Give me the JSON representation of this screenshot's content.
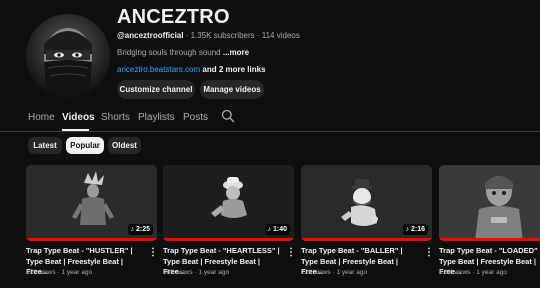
{
  "channel": {
    "name": "ANCEZTRO",
    "handle": "@anceztroofficial",
    "stats": "· 1.35K subscribers · 114 videos",
    "description": "Bridging souls through sound",
    "description_more": "...more",
    "link": "anceztro.beatstars.com",
    "more_links": "and 2 more links",
    "customize_label": "Customize channel",
    "manage_label": "Manage videos"
  },
  "tabs": [
    {
      "label": "Home",
      "active": false
    },
    {
      "label": "Videos",
      "active": true
    },
    {
      "label": "Shorts",
      "active": false
    },
    {
      "label": "Playlists",
      "active": false
    },
    {
      "label": "Posts",
      "active": false
    }
  ],
  "filters": [
    {
      "label": "Latest",
      "active": false
    },
    {
      "label": "Popular",
      "active": true
    },
    {
      "label": "Oldest",
      "active": false
    }
  ],
  "videos": [
    {
      "title": "Trap Type Beat - \"HUSTLER\" | Type Beat | Freestyle Beat | Free...",
      "duration": "2:25",
      "views": "62K views · 1 year ago",
      "watched": 1.0
    },
    {
      "title": "Trap Type Beat - \"HEARTLESS\" | Type Beat | Freestyle Beat | Free...",
      "duration": "1:40",
      "views": "38K views · 1 year ago",
      "watched": 1.0
    },
    {
      "title": "Trap Type Beat - \"BALLER\" | Type Beat | Freestyle Beat | Free...",
      "duration": "2:16",
      "views": "22K views · 1 year ago",
      "watched": 1.0
    },
    {
      "title": "Trap Type Beat - \"LOADED\" | Type Beat | Freestyle Beat | Free...",
      "duration": "",
      "views": "6.6K views · 1 year ago",
      "watched": 1.0
    }
  ],
  "colors": {
    "background": "#0f0f0f",
    "progress": "#ff0000",
    "link": "#3ea6ff"
  }
}
